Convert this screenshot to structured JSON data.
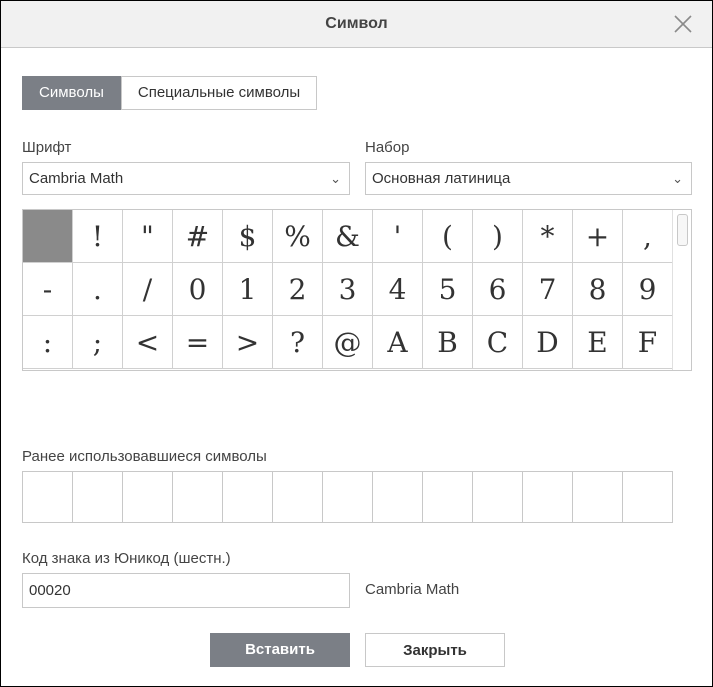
{
  "dialog": {
    "title": "Символ"
  },
  "tabs": [
    {
      "label": "Символы",
      "active": true
    },
    {
      "label": "Специальные символы",
      "active": false
    }
  ],
  "font": {
    "label": "Шрифт",
    "value": "Cambria Math"
  },
  "subset": {
    "label": "Набор",
    "value": "Основная латиница"
  },
  "symbols": [
    " ",
    "!",
    "\"",
    "#",
    "$",
    "%",
    "&",
    "'",
    "(",
    ")",
    "*",
    "+",
    ",",
    "-",
    ".",
    "/",
    "0",
    "1",
    "2",
    "3",
    "4",
    "5",
    "6",
    "7",
    "8",
    "9",
    ":",
    ";",
    "<",
    "=",
    ">",
    "?",
    "@",
    "A",
    "B",
    "C",
    "D",
    "E",
    "F"
  ],
  "selected_index": 0,
  "recent": {
    "label": "Ранее использовавшиеся символы",
    "count": 13
  },
  "unicode": {
    "label": "Код знака из Юникод (шестн.)",
    "value": "00020",
    "font_name": "Cambria Math"
  },
  "buttons": {
    "insert": "Вставить",
    "close": "Закрыть"
  },
  "colors": {
    "accent": "#7b7f86",
    "selected_cell": "#8a8a8a",
    "border": "#c8c8c8"
  }
}
